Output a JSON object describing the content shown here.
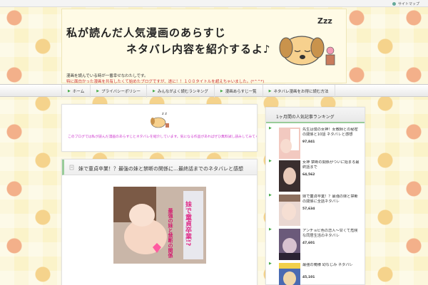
{
  "topbar": {
    "sitemap_label": "サイトマップ"
  },
  "header": {
    "title_line1": "私が読んだ人気漫画のあらすじ",
    "title_line2": "ネタバレ内容を紹介するよ♪",
    "desc_line1": "漫画を読んでいる時が一番幸せなわたしです。",
    "desc_line2": "特に面白かった漫画を共有したくて始めたブログですが、遂に！！１００タイトルを超えちゃいました。(*^^*)",
    "logo_text": "Zzz"
  },
  "nav": {
    "items": [
      {
        "label": "ホーム"
      },
      {
        "label": "プライバシーポリシー"
      },
      {
        "label": "みんながよく読むランキング"
      },
      {
        "label": "漫画あらすじ一覧"
      },
      {
        "label": "ネタバレ漫画をお得に読む方法"
      }
    ]
  },
  "intro": {
    "text": "このブログでは私が読んだ漫画のあらすじとネタバレを紹介しています。気になる作品があればぜひ無料試し読みしてみてくださいね♪"
  },
  "post": {
    "title": "妹で童貞卒業！？最強の妹と禁断の関係に…最終話までのネタバレと感想",
    "thumb_text_a": "妹で童貞卒業!?",
    "thumb_text_b": "最強の妹と禁断の関係"
  },
  "sidebar": {
    "heading": "1ヶ月間の人気記事ランキング",
    "items": [
      {
        "title": "先生は僕の女神！女教師との秘密の関係と10話 ネタバレと感想",
        "views": "97,841"
      },
      {
        "title": "女神 禁断の関係がついに始まる最終話まで",
        "views": "64,562"
      },
      {
        "title": "妹で童貞卒業！？最強の妹と禁断の関係に全話ネタバレ",
        "views": "57,634"
      },
      {
        "title": "アンチョビ色の恋人～甘くて危険な同居生活のネタバレ",
        "views": "47,601"
      },
      {
        "title": "最強の俺様 幼なじみ ネタバレ",
        "views": "45,101"
      }
    ]
  },
  "colors": {
    "accent": "#44aa44",
    "desc_red": "#cc3333",
    "intro_pink": "#cc33cc"
  }
}
